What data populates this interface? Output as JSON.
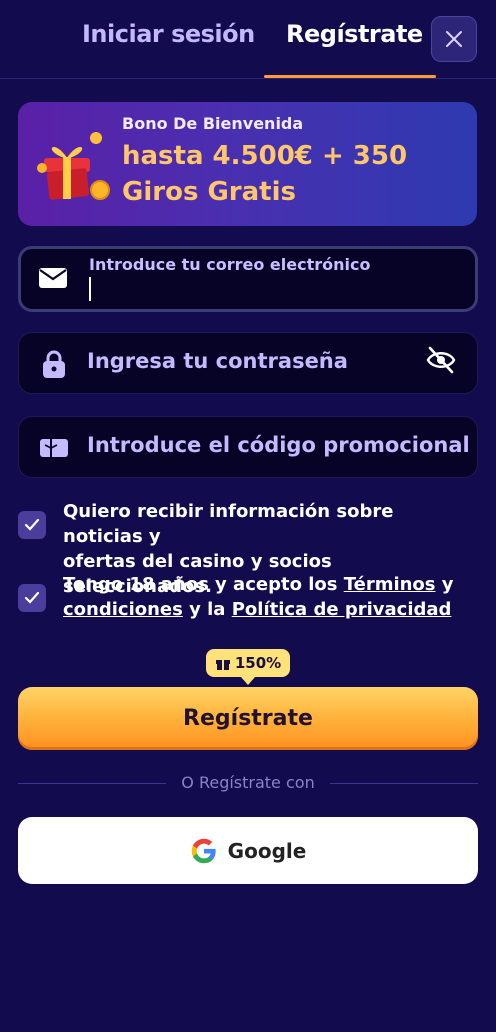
{
  "tabs": {
    "login": "Iniciar sesión",
    "register": "Regístrate"
  },
  "bonus": {
    "label": "Bono De Bienvenida",
    "line1": "hasta 4.500€ + 350",
    "line2": "Giros Gratis"
  },
  "fields": {
    "email": {
      "label": "Introduce tu correo electrónico",
      "value": ""
    },
    "password": {
      "placeholder": "Ingresa tu contraseña"
    },
    "promo": {
      "placeholder": "Introduce el código promocional"
    }
  },
  "consents": {
    "news": {
      "line1": "Quiero recibir información sobre noticias y",
      "line2": "ofertas del casino y socios seleccionados."
    },
    "age": {
      "prefix": "Tengo 18 años y acepto los ",
      "terms_a": "Términos",
      "terms_b": "condiciones",
      "mid": " y la ",
      "y": " y",
      "privacy": "Política de privacidad"
    }
  },
  "badge": {
    "value": "150%"
  },
  "register_button": "Regístrate",
  "divider": "O Regístrate con",
  "google_button": "Google",
  "colors": {
    "background": "#120b4e",
    "accent": "#ff9b3d",
    "field_bg": "#070327",
    "checkbox": "#4a3d9c",
    "bonus_text": "#ffc66b"
  },
  "icons": [
    "close-icon",
    "gift-box-icon",
    "envelope-icon",
    "lock-icon",
    "eye-off-icon",
    "ticket-icon",
    "check-icon",
    "gift-icon",
    "google-icon"
  ]
}
